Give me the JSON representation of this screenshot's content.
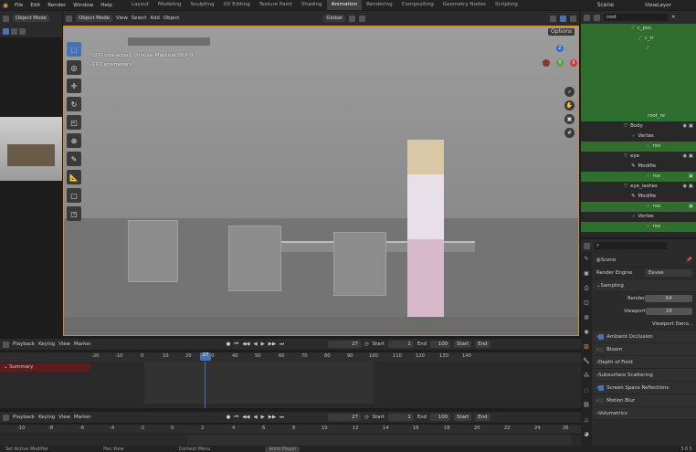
{
  "topbar": {
    "menus": [
      "File",
      "Edit",
      "Render",
      "Window",
      "Help"
    ],
    "workspaces": [
      "Layout",
      "Modeling",
      "Sculpting",
      "UV Editing",
      "Texture Paint",
      "Shading",
      "Animation",
      "Rendering",
      "Compositing",
      "Geometry Nodes",
      "Scripting"
    ],
    "active_workspace": "Animation",
    "scene": "Scene",
    "view_layer": "ViewLayer"
  },
  "left_header": {
    "mode": "Object Mode"
  },
  "viewport_header": {
    "mode": "Object Mode",
    "menus": [
      "View",
      "Select",
      "Add",
      "Object"
    ],
    "transform": "Global",
    "options": "Options"
  },
  "viewport": {
    "overlay_line1": "(27) character1 | house_Material.009_0",
    "overlay_line2": "10 Centimeters",
    "axis_z": "Z",
    "axis_x": "X",
    "axis_y": "Y"
  },
  "outliner": {
    "search": "root",
    "rows": [
      {
        "label": "c_pos",
        "green": true
      },
      {
        "label": "c_tr",
        "green": true
      },
      {
        "label": "",
        "green": true
      },
      {
        "label": "",
        "green": true
      },
      {
        "label": "",
        "green": true
      },
      {
        "label": "root_re",
        "green": true
      },
      {
        "label": "Body",
        "green": false
      },
      {
        "label": "Vertex",
        "green": false
      },
      {
        "label": "roo",
        "green": true
      },
      {
        "label": "eye",
        "green": false
      },
      {
        "label": "Modifie",
        "green": false
      },
      {
        "label": "roo",
        "green": true
      },
      {
        "label": "eye_lashes",
        "green": false
      },
      {
        "label": "Modifie",
        "green": false
      },
      {
        "label": "roo",
        "green": true
      },
      {
        "label": "Vertex",
        "green": false
      },
      {
        "label": "roo",
        "green": true
      }
    ]
  },
  "properties": {
    "scene": "Scene",
    "render_engine_label": "Render Engine",
    "render_engine": "Eevee",
    "sampling": "Sampling",
    "render_label": "Render",
    "render_value": "64",
    "viewport_label": "Viewport",
    "viewport_value": "16",
    "viewport_denoise": "Viewport Deno...",
    "sections": [
      {
        "label": "Ambient Occlusion",
        "checkbox": true
      },
      {
        "label": "Bloom",
        "checkbox": false
      },
      {
        "label": "Depth of Field",
        "checkbox": null
      },
      {
        "label": "Subsurface Scattering",
        "checkbox": null
      },
      {
        "label": "Screen Space Reflections",
        "checkbox": true
      },
      {
        "label": "Motion Blur",
        "checkbox": false
      },
      {
        "label": "Volumetrics",
        "checkbox": null
      }
    ]
  },
  "timeline1": {
    "playback": "Playback",
    "keying": "Keying",
    "view": "View",
    "marker": "Marker",
    "current_frame": "27",
    "start_label": "Start",
    "start": "1",
    "end_label": "End",
    "end": "100",
    "start_btn": "Start",
    "end_btn": "End",
    "ticks": [
      "-20",
      "-10",
      "0",
      "10",
      "20",
      "30",
      "40",
      "50",
      "60",
      "70",
      "80",
      "90",
      "100",
      "110",
      "120",
      "130",
      "140"
    ],
    "playhead": "27",
    "summary": "Summary"
  },
  "timeline2": {
    "playback": "Playback",
    "keying": "Keying",
    "view": "View",
    "marker": "Marker",
    "current_frame": "27",
    "start_label": "Start",
    "start": "1",
    "end_label": "End",
    "end": "100",
    "start_btn": "Start",
    "end_btn": "End",
    "ticks": [
      "-10",
      "-8",
      "-6",
      "-4",
      "-2",
      "0",
      "2",
      "4",
      "6",
      "8",
      "10",
      "12",
      "14",
      "16",
      "18",
      "20",
      "22",
      "24",
      "26"
    ]
  },
  "status": {
    "items": [
      "Set Active Modifier",
      "Pan View",
      "Context Menu",
      "Anim Player"
    ],
    "version": "3.6.5"
  }
}
